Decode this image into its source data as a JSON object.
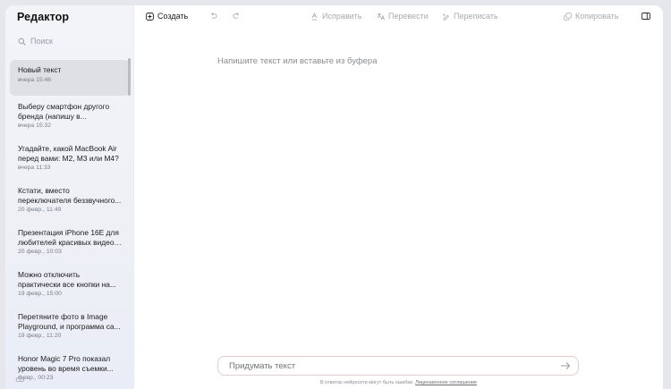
{
  "app": {
    "title": "Редактор"
  },
  "search": {
    "placeholder": "Поиск"
  },
  "documents": [
    {
      "title": "Новый текст",
      "date": "вчера 15:46",
      "active": true
    },
    {
      "title": "Выберу смартфон другого бренда (напишу в...",
      "date": "вчера 15:32"
    },
    {
      "title": "Угадайте, какой MacBook Air перед вами: M2, M3 или M4?",
      "date": "вчера 11:33"
    },
    {
      "title": "Кстати, вместо переключателя беззвучного...",
      "date": "20 февр., 11:49"
    },
    {
      "title": "Презентация iPhone 16E для любителей красивых видео ...",
      "date": "20 февр., 10:03"
    },
    {
      "title": "Можно отключить практически все кнопки на...",
      "date": "19 февр., 15:00"
    },
    {
      "title": "Перетяните фото в Image Playground, и программа са...",
      "date": "19 февр., 11:20"
    },
    {
      "title": "Honor Magic 7 Pro показал уровень во время съемки...",
      "date": "февр., 00:23"
    }
  ],
  "toolbar": {
    "create": "Создать",
    "fix": "Исправить",
    "translate": "Перевести",
    "rewrite": "Переписать",
    "copy": "Копировать"
  },
  "editor": {
    "placeholder": "Напишите текст или вставьте из буфера"
  },
  "prompt": {
    "placeholder": "Придумать текст"
  },
  "footer": {
    "disclaimer": "В ответах нейросети могут быть ошибки.",
    "license_link": "Лицензионное соглашение"
  }
}
